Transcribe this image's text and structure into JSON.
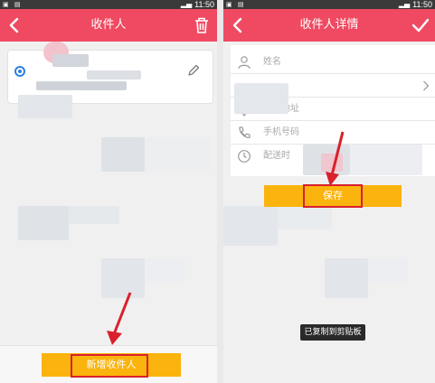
{
  "left_screen": {
    "status_time": "11:50",
    "title": "收件人",
    "add_button_label": "新增收件人"
  },
  "right_screen": {
    "status_time": "11:50",
    "title": "收件人详情",
    "fields": [
      {
        "label": "姓名",
        "icon": "person-icon"
      },
      {
        "label": "",
        "icon": "none",
        "has_chevron": true
      },
      {
        "label": "详细地址",
        "icon": "location-icon"
      },
      {
        "label": "手机号码",
        "icon": "phone-icon"
      },
      {
        "label": "配送时",
        "icon": "clock-icon"
      }
    ],
    "save_button_label": "保存",
    "toast": "已复制到剪贴板"
  },
  "colors": {
    "accent": "#ef4a62",
    "button": "#fbb30d",
    "highlight_border": "#d9202c",
    "radio": "#2f7fe2"
  }
}
